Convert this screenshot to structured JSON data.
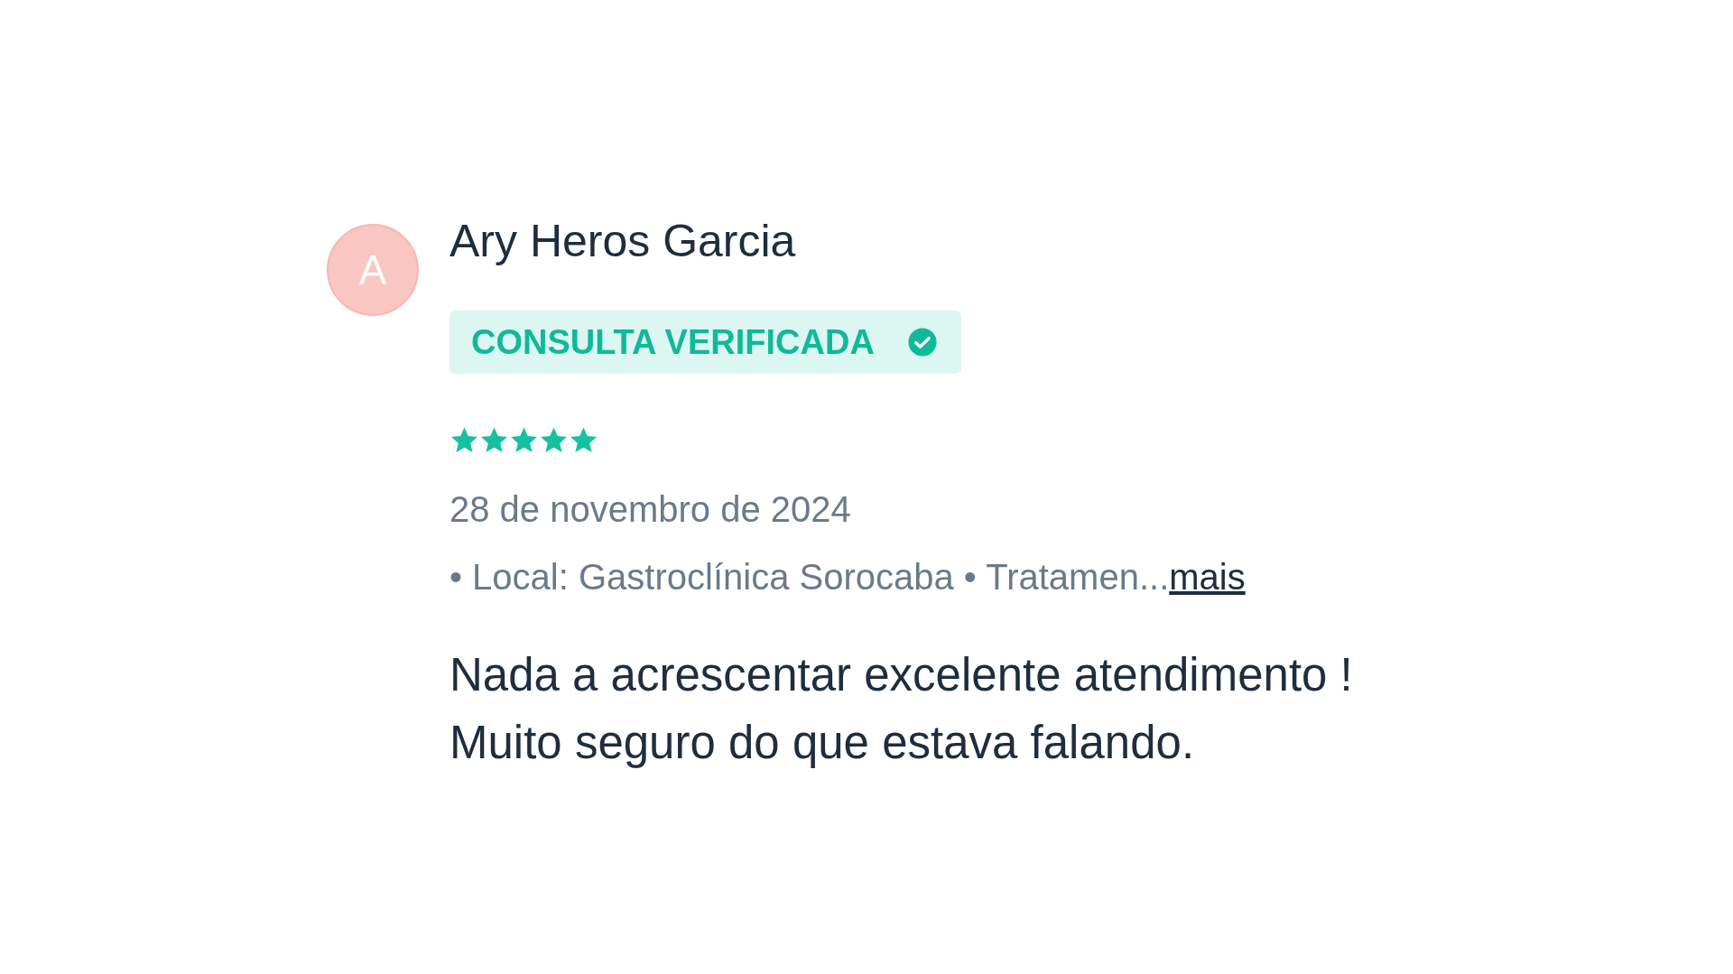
{
  "review": {
    "avatar_letter": "A",
    "author": "Ary Heros Garcia",
    "badge": {
      "label": "CONSULTA VERIFICADA",
      "verified": true
    },
    "stars": 5,
    "date": "28 de novembro de 2024",
    "details": "• Local: Gastroclínica Sorocaba • Tratamen...",
    "more_link": "mais",
    "text_lines": [
      "Nada a acrescentar excelente atendimento !",
      "Muito seguro do que estava falando."
    ]
  }
}
